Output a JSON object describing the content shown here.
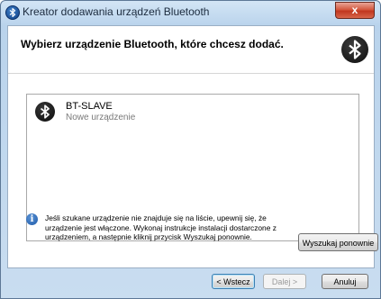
{
  "window": {
    "title": "Kreator dodawania urządzeń Bluetooth",
    "close_symbol": "x"
  },
  "header": {
    "title": "Wybierz urządzenie Bluetooth, które chcesz dodać.",
    "icon": "bluetooth-icon"
  },
  "devices": [
    {
      "name": "BT-SLAVE",
      "status": "Nowe urządzenie",
      "icon": "bluetooth-icon"
    }
  ],
  "info": {
    "icon": "info-icon",
    "symbol": "i",
    "text": "Jeśli szukane urządzenie nie znajduje się na liście, upewnij się, że urządzenie jest włączone. Wykonaj instrukcje instalacji dostarczone z urządzeniem, a następnie kliknij przycisk Wyszukaj ponownie."
  },
  "buttons": {
    "search_again": "Wyszukaj ponownie",
    "back": "< Wstecz",
    "next": "Dalej >",
    "cancel": "Anuluj"
  },
  "colors": {
    "frame": "#b9d3ec",
    "close_button": "#c1371f",
    "bluetooth_dark": "#0d0d0d",
    "bluetooth_blue": "#0e3f86"
  }
}
